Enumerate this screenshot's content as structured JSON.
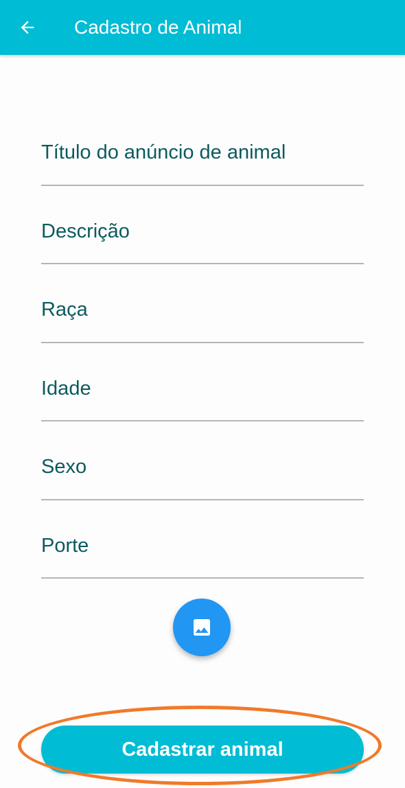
{
  "appbar": {
    "title": "Cadastro de Animal",
    "back_icon": "arrow-left-icon",
    "background": "#00bcd4"
  },
  "form": {
    "fields": [
      {
        "name": "titulo",
        "placeholder": "Título do anúncio de animal",
        "value": ""
      },
      {
        "name": "descricao",
        "placeholder": "Descrição",
        "value": ""
      },
      {
        "name": "raca",
        "placeholder": "Raça",
        "value": ""
      },
      {
        "name": "idade",
        "placeholder": "Idade",
        "value": ""
      },
      {
        "name": "sexo",
        "placeholder": "Sexo",
        "value": ""
      },
      {
        "name": "porte",
        "placeholder": "Porte",
        "value": ""
      }
    ],
    "text_color": "#0c5a5e"
  },
  "image_button": {
    "icon": "image-icon",
    "color": "#2196f3"
  },
  "submit": {
    "label": "Cadastrar animal",
    "color": "#00bcd4"
  },
  "annotation": {
    "color": "#f07a2a"
  }
}
